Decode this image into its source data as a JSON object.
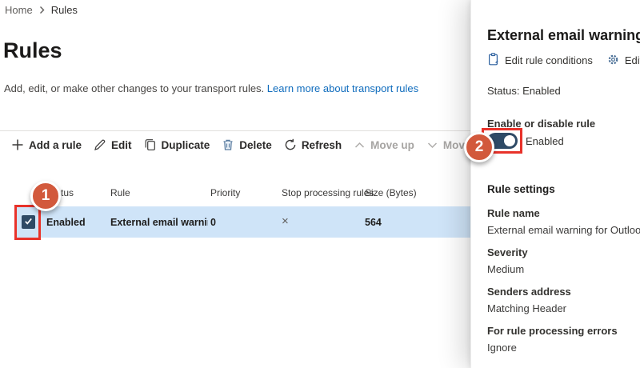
{
  "breadcrumb": {
    "home": "Home",
    "current": "Rules"
  },
  "page": {
    "title": "Rules",
    "description": "Add, edit, or make other changes to your transport rules. ",
    "learn_more_link": "Learn more about transport rules"
  },
  "toolbar": {
    "items": [
      {
        "label": "Add a rule",
        "icon": "plus-icon",
        "enabled": true
      },
      {
        "label": "Edit",
        "icon": "pencil-icon",
        "enabled": true
      },
      {
        "label": "Duplicate",
        "icon": "copy-icon",
        "enabled": true
      },
      {
        "label": "Delete",
        "icon": "trash-icon",
        "enabled": true
      },
      {
        "label": "Refresh",
        "icon": "refresh-icon",
        "enabled": true
      },
      {
        "label": "Move up",
        "icon": "chevron-up-icon",
        "enabled": false
      },
      {
        "label": "Move down",
        "icon": "chevron-down-icon",
        "enabled": false
      }
    ]
  },
  "table": {
    "headers": [
      "Status",
      "Rule",
      "Priority",
      "Stop processing rules",
      "Size (Bytes)"
    ],
    "row": {
      "selected": true,
      "checked": true,
      "status": "Enabled",
      "rule": "External email warnin...",
      "priority": "0",
      "stop_processing": "×",
      "size_bytes": "564"
    }
  },
  "panel": {
    "title": "External email warning",
    "actions": [
      {
        "label": "Edit rule conditions",
        "icon": "clipboard-icon"
      },
      {
        "label": "Edit ru",
        "icon": "gear-icon"
      }
    ],
    "status_line": "Status: Enabled",
    "toggle": {
      "label": "Enable or disable rule",
      "state_text": "Enabled",
      "on": true
    },
    "settings_heading": "Rule settings",
    "fields": [
      {
        "label": "Rule name",
        "value": "External email warning for Outlook"
      },
      {
        "label": "Severity",
        "value": "Medium"
      },
      {
        "label": "Senders address",
        "value": "Matching Header"
      },
      {
        "label": "For rule processing errors",
        "value": "Ignore"
      }
    ]
  },
  "annotations": {
    "step1": "1",
    "step2": "2",
    "circle_color": "#d2593c",
    "box_color": "#e8322a"
  },
  "colors": {
    "accent_link": "#0f6cbd",
    "toggle_on": "#2e4a66",
    "selected_row": "#cfe4f8"
  }
}
